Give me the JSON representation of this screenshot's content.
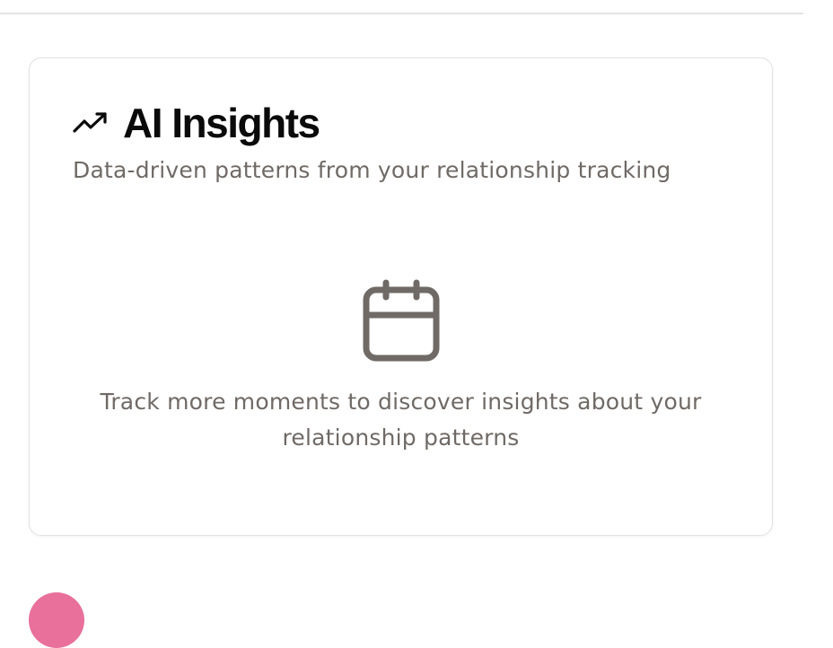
{
  "insights_card": {
    "title": "AI Insights",
    "subtitle": "Data-driven patterns from your relationship tracking",
    "title_icon": "trending-up-icon",
    "empty_state": {
      "icon": "calendar-icon",
      "message": "Track more moments to discover insights about your relationship patterns"
    }
  },
  "next_section": {
    "icon_color": "#e8709a",
    "heading": ""
  },
  "colors": {
    "title": "#0a0a0a",
    "muted_text": "#6f6a66",
    "icon_gray": "#6f6a66",
    "card_border": "#e2e2e2",
    "accent_pink": "#e8709a"
  }
}
